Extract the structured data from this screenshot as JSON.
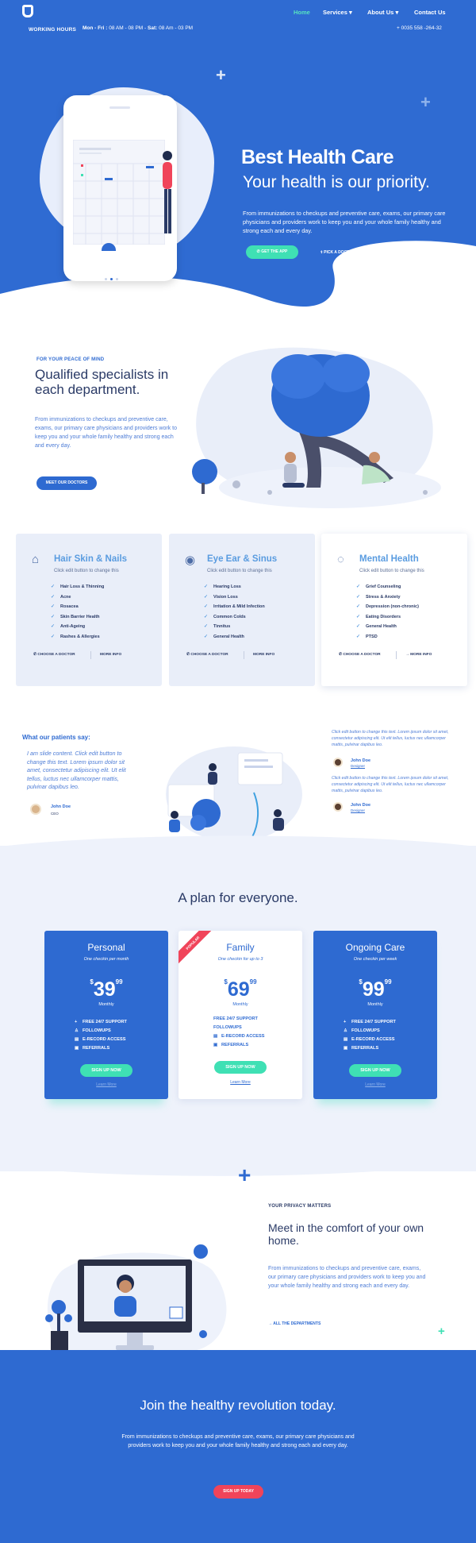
{
  "header": {
    "logo_text": "WORKING HOURS",
    "hours_label_1": "Mon - Fri :",
    "hours_value_1": "08 AM - 08 PM",
    "hours_label_2": "Sat:",
    "hours_value_2": "08 Am - 03 PM",
    "phone": "+ 0035 558 -264-32",
    "nav": [
      {
        "label": "Home"
      },
      {
        "label": "Services"
      },
      {
        "label": "About Us"
      },
      {
        "label": "Contact Us"
      }
    ]
  },
  "hero": {
    "title": "Best Health Care",
    "subtitle": "Your health is our priority.",
    "text": "From immunizations to checkups and  preventive care,  exams, our primary care physicians and providers work to keep you and your whole family healthy and strong each and every day.",
    "primary_button": "GET THE APP",
    "secondary_button": "PICK A DOCTOR"
  },
  "specialists": {
    "kicker": "FOR YOUR PEACE OF MIND",
    "title": "Qualified specialists in each department.",
    "text": "From immunizations to checkups and  preventive care, exams, our primary care physicians and providers work to keep you and your whole family healthy and strong each and every day.",
    "button": "MEET OUR DOCTORS"
  },
  "services": [
    {
      "title": "Hair Skin & Nails",
      "subtitle": "Click edit button to change this",
      "items": [
        "Hair Loss & Thinning",
        "Acne",
        "Rosacea",
        "Skin Barrier Health",
        "Anti-Ageing",
        "Rashes & Allergies"
      ],
      "choose": "CHOOSE A DOCTOR",
      "more": "MORE INFO"
    },
    {
      "title": "Eye Ear & Sinus",
      "subtitle": "Click edit button to change this",
      "items": [
        "Hearing Loss",
        "Vision Loss",
        "Irritation & Mild Infection",
        "Common Colds",
        "Tinnitus",
        "General Health"
      ],
      "choose": "CHOOSE A DOCTOR",
      "more": "MORE INFO"
    },
    {
      "title": "Mental Health",
      "subtitle": "Click edit button to change this",
      "items": [
        "Grief Counseling",
        "Stress & Anxiety",
        "Depression (non-chronic)",
        "Eating Disorders",
        "General Health",
        "PTSD"
      ],
      "choose": "CHOOSE A DOCTOR",
      "more": "MORE INFO"
    }
  ],
  "testimonials": {
    "heading": "What our patients say:",
    "main_quote": "I am slide content. Click edit button to change this text. Lorem ipsum dolor sit amet, consectetur adipiscing elit. Ut elit tellus, luctus nec ullamcorper mattis, pulvinar dapibus leo.",
    "main_name": "John Doe",
    "main_role": "CEO",
    "side": [
      {
        "quote": "Click edit button to change this text. Lorem ipsum dolor sit amet, consectetur adipiscing elit. Ut elit tellus, luctus nec ullamcorper mattis, pulvinar dapibus leo.",
        "name": "John Doe",
        "role": "Designer"
      },
      {
        "quote": "Click edit button to change this text. Lorem ipsum dolor sit amet, consectetur adipiscing elit. Ut elit tellus, luctus nec ullamcorper mattis, pulvinar dapibus leo.",
        "name": "John Doe",
        "role": "Designer"
      }
    ]
  },
  "pricing": {
    "heading": "A plan for everyone.",
    "plans": [
      {
        "name": "Personal",
        "sub": "One checkin per month",
        "currency": "$",
        "price": "39",
        "cents": "99",
        "period": "Monthly",
        "features": [
          "FREE 24/7 SUPPORT",
          "FOLLOWUPS",
          "E-RECORD ACCESS",
          "REFERRALS"
        ],
        "button": "SIGN UP NOW",
        "learn": "Learn More"
      },
      {
        "name": "Family",
        "sub": "One checkin for up to 3",
        "currency": "$",
        "price": "69",
        "cents": "99",
        "period": "Monthly",
        "features": [
          "FREE 24/7 SUPPORT",
          "FOLLOWUPS",
          "E-RECORD ACCESS",
          "REFERRALS"
        ],
        "button": "SIGN UP NOW",
        "learn": "Learn More",
        "ribbon": "POPULAR"
      },
      {
        "name": "Ongoing Care",
        "sub": "One checkin per week",
        "currency": "$",
        "price": "99",
        "cents": "99",
        "period": "Monthly",
        "features": [
          "FREE 24/7 SUPPORT",
          "FOLLOWUPS",
          "E-RECORD ACCESS",
          "REFERRALS"
        ],
        "button": "SIGN UP NOW",
        "learn": "Learn More"
      }
    ]
  },
  "privacy": {
    "kicker": "YOUR PRIVACY MATTERS",
    "title": "Meet in the comfort of your own home.",
    "text": "From immunizations to checkups and  preventive care, exams, our primary care physicians and providers work to keep you and your whole family healthy and strong each and every day.",
    "link": "ALL THE DEPARTMENTS"
  },
  "cta": {
    "title": "Join the healthy revolution today.",
    "text": "From immunizations to checkups and  preventive care,  exams, our primary care physicians and providers work to keep you and your whole family healthy and strong each and every day.",
    "button": "SIGN UP TODAY"
  },
  "colors": {
    "brand_blue": "#2e6ad1",
    "accent_green": "#3fe0b4",
    "accent_red": "#f0445a",
    "light_bg": "#eef2fb"
  }
}
